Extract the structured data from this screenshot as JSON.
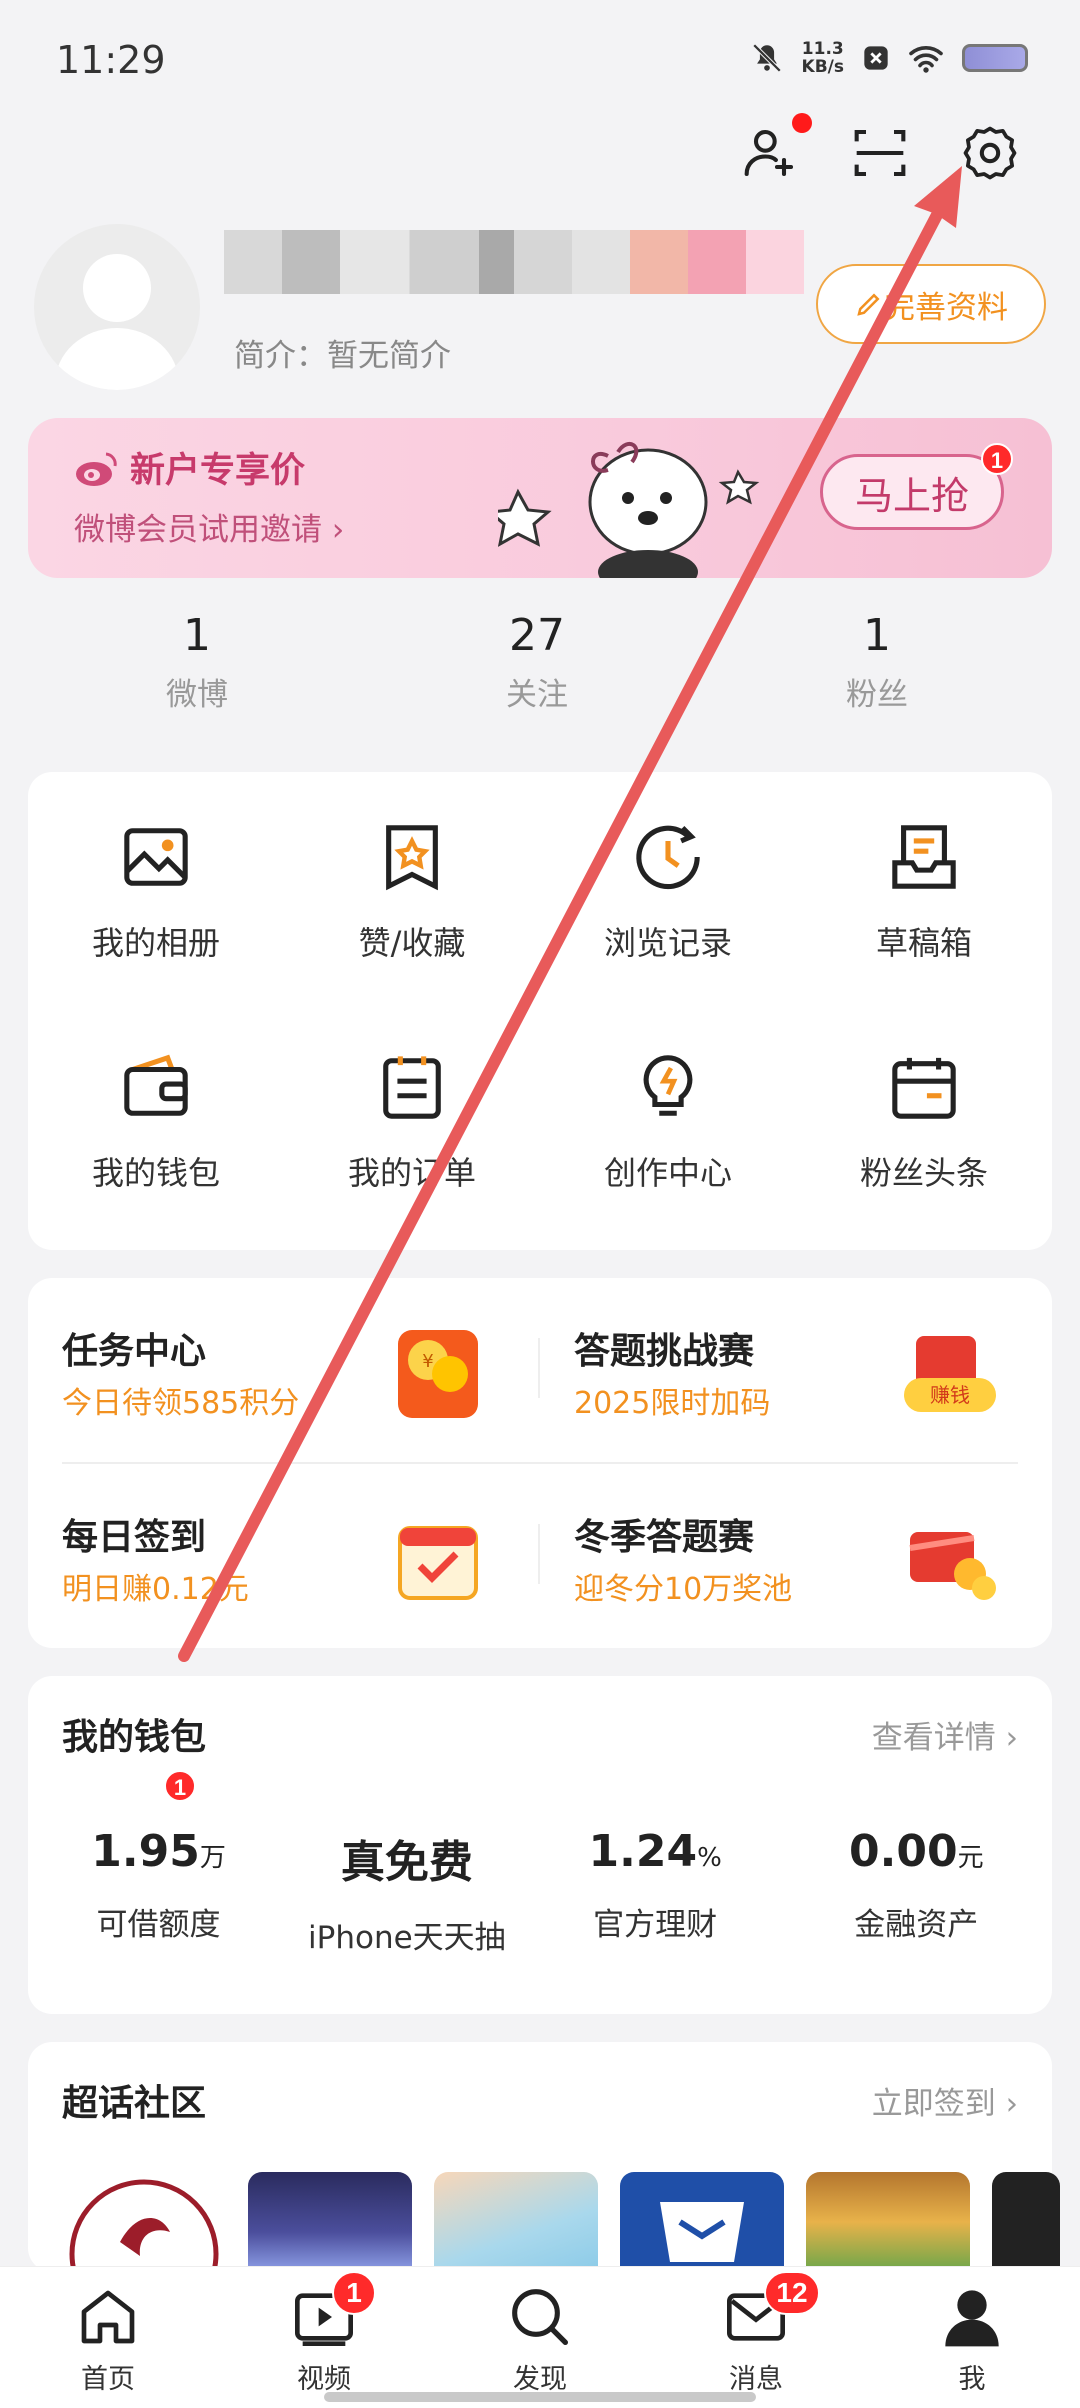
{
  "status_bar": {
    "time": "11:29",
    "net_speed_value": "11.3",
    "net_speed_unit": "KB/s"
  },
  "header_icons": [
    "add-friend-icon",
    "scan-icon",
    "settings-icon"
  ],
  "profile": {
    "bio": "简介：暂无简介",
    "edit_button": "完善资料"
  },
  "vip_banner": {
    "title": "新户专享价",
    "subtitle": "微博会员试用邀请",
    "button": "马上抢",
    "badge": "1"
  },
  "stats": [
    {
      "value": "1",
      "label": "微博"
    },
    {
      "value": "27",
      "label": "关注"
    },
    {
      "value": "1",
      "label": "粉丝"
    }
  ],
  "grid_items": [
    {
      "label": "我的相册",
      "icon": "album-icon"
    },
    {
      "label": "赞/收藏",
      "icon": "favorites-icon"
    },
    {
      "label": "浏览记录",
      "icon": "history-icon"
    },
    {
      "label": "草稿箱",
      "icon": "drafts-icon"
    },
    {
      "label": "我的钱包",
      "icon": "wallet-icon"
    },
    {
      "label": "我的订单",
      "icon": "orders-icon"
    },
    {
      "label": "创作中心",
      "icon": "creator-icon"
    },
    {
      "label": "粉丝头条",
      "icon": "fan-headline-icon"
    }
  ],
  "tasks": [
    {
      "title": "任务中心",
      "subtitle": "今日待领585积分"
    },
    {
      "title": "答题挑战赛",
      "subtitle": "2025限时加码",
      "tag": "赚钱"
    },
    {
      "title": "每日签到",
      "subtitle": "明日赚0.12元"
    },
    {
      "title": "冬季答题赛",
      "subtitle": "迎冬分10万奖池"
    }
  ],
  "wallet": {
    "title": "我的钱包",
    "link": "查看详情",
    "badge": "1",
    "items": [
      {
        "value": "1.95",
        "unit": "万",
        "label": "可借额度"
      },
      {
        "value": "真免费",
        "unit": "",
        "label": "iPhone天天抽"
      },
      {
        "value": "1.24",
        "unit": "%",
        "label": "官方理财"
      },
      {
        "value": "0.00",
        "unit": "元",
        "label": "金融资产"
      }
    ]
  },
  "super_topic": {
    "title": "超话社区",
    "link": "立即签到"
  },
  "tabbar": [
    {
      "label": "首页",
      "icon": "home-icon"
    },
    {
      "label": "视频",
      "icon": "video-icon",
      "badge": "1"
    },
    {
      "label": "发现",
      "icon": "search-icon"
    },
    {
      "label": "消息",
      "icon": "mail-icon",
      "badge": "12"
    },
    {
      "label": "我",
      "icon": "profile-icon"
    }
  ],
  "colors": {
    "accent_orange": "#f29120",
    "vip_pink": "#c73a6b",
    "badge_red": "#ff2a2a",
    "annotation_arrow": "#e85a5a"
  }
}
